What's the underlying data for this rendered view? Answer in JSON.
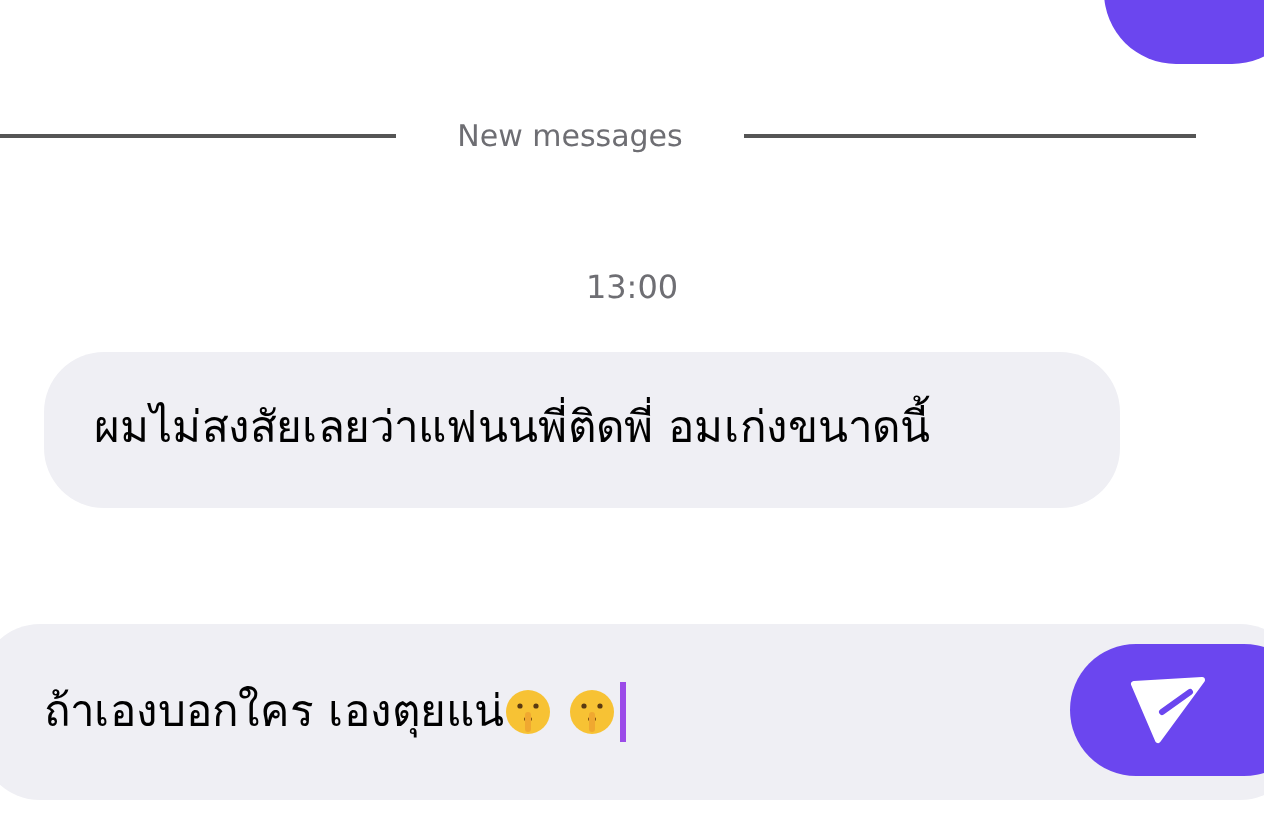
{
  "divider": {
    "label": "New messages"
  },
  "timestamp": "13:00",
  "messages": [
    {
      "kind": "incoming",
      "text": "ผมไม่สงสัยเลยว่าแฟนนพี่ติดพี่ อมเก่งขนาดนี้"
    }
  ],
  "composer": {
    "value": "ถ้าเองบอกใคร เองตุยแน่"
  }
}
